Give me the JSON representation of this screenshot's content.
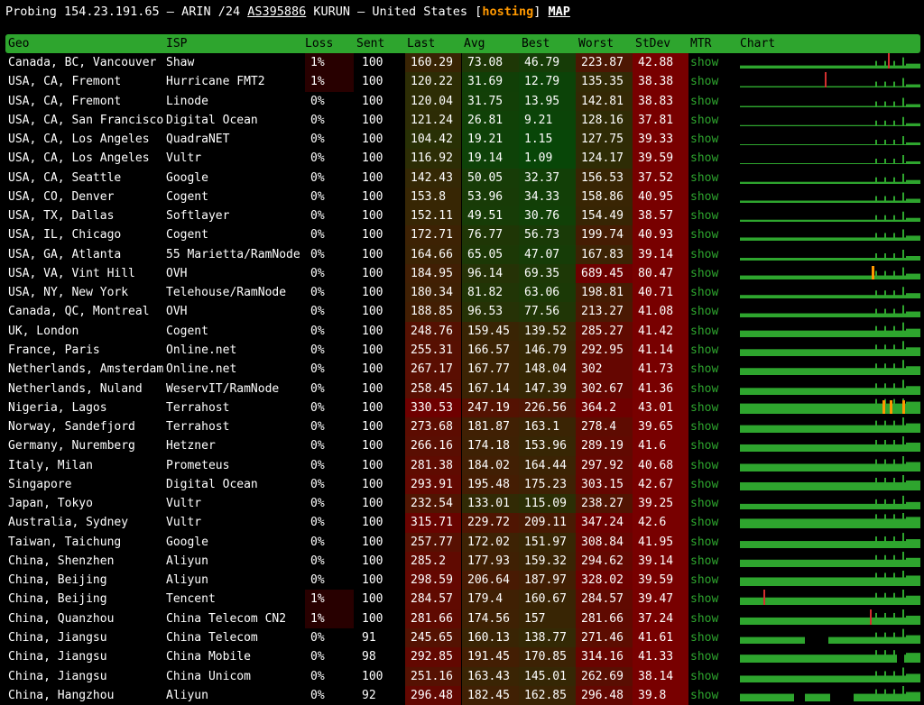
{
  "title": {
    "prefix": "Probing 154.23.191.65 – ARIN /24 ",
    "asn": "AS395886",
    "mid": " KURUN – United States [",
    "hosting": "hosting",
    "suffix": "] ",
    "map": "MAP"
  },
  "headers": [
    "Geo",
    "ISP",
    "Loss",
    "Sent",
    "Last",
    "Avg",
    "Best",
    "Worst",
    "StDev",
    "MTR",
    "Chart"
  ],
  "mtr_label": "show",
  "colors": {
    "accent": "#2ea52e",
    "red": "#d32f2f",
    "orange": "#ff9800",
    "dark_red": "#700000",
    "dark_green": "#0a3a0a"
  },
  "rows": [
    {
      "geo": "Canada, BC, Vancouver",
      "isp": "Shaw",
      "loss": "1%",
      "sent": "100",
      "last": "160.29",
      "avg": "73.08",
      "best": "46.79",
      "worst": "223.87",
      "stdev": "42.88",
      "spike": 0.82
    },
    {
      "geo": "USA, CA, Fremont",
      "isp": "Hurricane FMT2",
      "loss": "1%",
      "sent": "100",
      "last": "120.22",
      "avg": "31.69",
      "best": "12.79",
      "worst": "135.35",
      "stdev": "38.38",
      "spike": 0.47
    },
    {
      "geo": "USA, CA, Fremont",
      "isp": "Linode",
      "loss": "0%",
      "sent": "100",
      "last": "120.04",
      "avg": "31.75",
      "best": "13.95",
      "worst": "142.81",
      "stdev": "38.83"
    },
    {
      "geo": "USA, CA, San Francisco",
      "isp": "Digital Ocean",
      "loss": "0%",
      "sent": "100",
      "last": "121.24",
      "avg": "26.81",
      "best": "9.21",
      "worst": "128.16",
      "stdev": "37.81"
    },
    {
      "geo": "USA, CA, Los Angeles",
      "isp": "QuadraNET",
      "loss": "0%",
      "sent": "100",
      "last": "104.42",
      "avg": "19.21",
      "best": "1.15",
      "worst": "127.75",
      "stdev": "39.33"
    },
    {
      "geo": "USA, CA, Los Angeles",
      "isp": "Vultr",
      "loss": "0%",
      "sent": "100",
      "last": "116.92",
      "avg": "19.14",
      "best": "1.09",
      "worst": "124.17",
      "stdev": "39.59"
    },
    {
      "geo": "USA, CA, Seattle",
      "isp": "Google",
      "loss": "0%",
      "sent": "100",
      "last": "142.43",
      "avg": "50.05",
      "best": "32.37",
      "worst": "156.53",
      "stdev": "37.52"
    },
    {
      "geo": "USA, CO, Denver",
      "isp": "Cogent",
      "loss": "0%",
      "sent": "100",
      "last": "153.8",
      "avg": "53.96",
      "best": "34.33",
      "worst": "158.86",
      "stdev": "40.95"
    },
    {
      "geo": "USA, TX, Dallas",
      "isp": "Softlayer",
      "loss": "0%",
      "sent": "100",
      "last": "152.11",
      "avg": "49.51",
      "best": "30.76",
      "worst": "154.49",
      "stdev": "38.57"
    },
    {
      "geo": "USA, IL, Chicago",
      "isp": "Cogent",
      "loss": "0%",
      "sent": "100",
      "last": "172.71",
      "avg": "76.77",
      "best": "56.73",
      "worst": "199.74",
      "stdev": "40.93"
    },
    {
      "geo": "USA, GA, Atlanta",
      "isp": "55 Marietta/RamNode",
      "loss": "0%",
      "sent": "100",
      "last": "164.66",
      "avg": "65.05",
      "best": "47.07",
      "worst": "167.83",
      "stdev": "39.14"
    },
    {
      "geo": "USA, VA, Vint Hill",
      "isp": "OVH",
      "loss": "0%",
      "sent": "100",
      "last": "184.95",
      "avg": "96.14",
      "best": "69.35",
      "worst": "689.45",
      "stdev": "80.47",
      "orange": [
        0.73
      ]
    },
    {
      "geo": "USA, NY, New York",
      "isp": "Telehouse/RamNode",
      "loss": "0%",
      "sent": "100",
      "last": "180.34",
      "avg": "81.82",
      "best": "63.06",
      "worst": "198.81",
      "stdev": "40.71"
    },
    {
      "geo": "Canada, QC, Montreal",
      "isp": "OVH",
      "loss": "0%",
      "sent": "100",
      "last": "188.85",
      "avg": "96.53",
      "best": "77.56",
      "worst": "213.27",
      "stdev": "41.08"
    },
    {
      "geo": "UK, London",
      "isp": "Cogent",
      "loss": "0%",
      "sent": "100",
      "last": "248.76",
      "avg": "159.45",
      "best": "139.52",
      "worst": "285.27",
      "stdev": "41.42"
    },
    {
      "geo": "France, Paris",
      "isp": "Online.net",
      "loss": "0%",
      "sent": "100",
      "last": "255.31",
      "avg": "166.57",
      "best": "146.79",
      "worst": "292.95",
      "stdev": "41.14"
    },
    {
      "geo": "Netherlands, Amsterdam",
      "isp": "Online.net",
      "loss": "0%",
      "sent": "100",
      "last": "267.17",
      "avg": "167.77",
      "best": "148.04",
      "worst": "302",
      "stdev": "41.73"
    },
    {
      "geo": "Netherlands, Nuland",
      "isp": "WeservIT/RamNode",
      "loss": "0%",
      "sent": "100",
      "last": "258.45",
      "avg": "167.14",
      "best": "147.39",
      "worst": "302.67",
      "stdev": "41.36"
    },
    {
      "geo": "Nigeria, Lagos",
      "isp": "Terrahost",
      "loss": "0%",
      "sent": "100",
      "last": "330.53",
      "avg": "247.19",
      "best": "226.56",
      "worst": "364.2",
      "stdev": "43.01",
      "orange": [
        0.79,
        0.83,
        0.9
      ]
    },
    {
      "geo": "Norway, Sandefjord",
      "isp": "Terrahost",
      "loss": "0%",
      "sent": "100",
      "last": "273.68",
      "avg": "181.87",
      "best": "163.1",
      "worst": "278.4",
      "stdev": "39.65"
    },
    {
      "geo": "Germany, Nuremberg",
      "isp": "Hetzner",
      "loss": "0%",
      "sent": "100",
      "last": "266.16",
      "avg": "174.18",
      "best": "153.96",
      "worst": "289.19",
      "stdev": "41.6"
    },
    {
      "geo": "Italy, Milan",
      "isp": "Prometeus",
      "loss": "0%",
      "sent": "100",
      "last": "281.38",
      "avg": "184.02",
      "best": "164.44",
      "worst": "297.92",
      "stdev": "40.68"
    },
    {
      "geo": "Singapore",
      "isp": "Digital Ocean",
      "loss": "0%",
      "sent": "100",
      "last": "293.91",
      "avg": "195.48",
      "best": "175.23",
      "worst": "303.15",
      "stdev": "42.67"
    },
    {
      "geo": "Japan, Tokyo",
      "isp": "Vultr",
      "loss": "0%",
      "sent": "100",
      "last": "232.54",
      "avg": "133.01",
      "best": "115.09",
      "worst": "238.27",
      "stdev": "39.25"
    },
    {
      "geo": "Australia, Sydney",
      "isp": "Vultr",
      "loss": "0%",
      "sent": "100",
      "last": "315.71",
      "avg": "229.72",
      "best": "209.11",
      "worst": "347.24",
      "stdev": "42.6"
    },
    {
      "geo": "Taiwan, Taichung",
      "isp": "Google",
      "loss": "0%",
      "sent": "100",
      "last": "257.77",
      "avg": "172.02",
      "best": "151.97",
      "worst": "308.84",
      "stdev": "41.95"
    },
    {
      "geo": "China, Shenzhen",
      "isp": "Aliyun",
      "loss": "0%",
      "sent": "100",
      "last": "285.2",
      "avg": "177.93",
      "best": "159.32",
      "worst": "294.62",
      "stdev": "39.14"
    },
    {
      "geo": "China, Beijing",
      "isp": "Aliyun",
      "loss": "0%",
      "sent": "100",
      "last": "298.59",
      "avg": "206.64",
      "best": "187.97",
      "worst": "328.02",
      "stdev": "39.59"
    },
    {
      "geo": "China, Beijing",
      "isp": "Tencent",
      "loss": "1%",
      "sent": "100",
      "last": "284.57",
      "avg": "179.4",
      "best": "160.67",
      "worst": "284.57",
      "stdev": "39.47",
      "spike": 0.13
    },
    {
      "geo": "China, Quanzhou",
      "isp": "China Telecom CN2",
      "loss": "1%",
      "sent": "100",
      "last": "281.66",
      "avg": "174.56",
      "best": "157",
      "worst": "281.66",
      "stdev": "37.24",
      "spike": 0.72
    },
    {
      "geo": "China, Jiangsu",
      "isp": "China Telecom",
      "loss": "0%",
      "sent": "91",
      "last": "245.65",
      "avg": "160.13",
      "best": "138.77",
      "worst": "271.46",
      "stdev": "41.61",
      "gaps": [
        [
          0.36,
          0.48
        ]
      ]
    },
    {
      "geo": "China, Jiangsu",
      "isp": "China Mobile",
      "loss": "0%",
      "sent": "98",
      "last": "292.85",
      "avg": "191.45",
      "best": "170.85",
      "worst": "314.16",
      "stdev": "41.33",
      "gaps": [
        [
          0.87,
          0.9
        ]
      ]
    },
    {
      "geo": "China, Jiangsu",
      "isp": "China Unicom",
      "loss": "0%",
      "sent": "100",
      "last": "251.16",
      "avg": "163.43",
      "best": "145.01",
      "worst": "262.69",
      "stdev": "38.14"
    },
    {
      "geo": "China, Hangzhou",
      "isp": "Aliyun",
      "loss": "0%",
      "sent": "92",
      "last": "296.48",
      "avg": "182.45",
      "best": "162.85",
      "worst": "296.48",
      "stdev": "39.8",
      "gaps": [
        [
          0.3,
          0.35
        ],
        [
          0.5,
          0.62
        ]
      ]
    }
  ]
}
